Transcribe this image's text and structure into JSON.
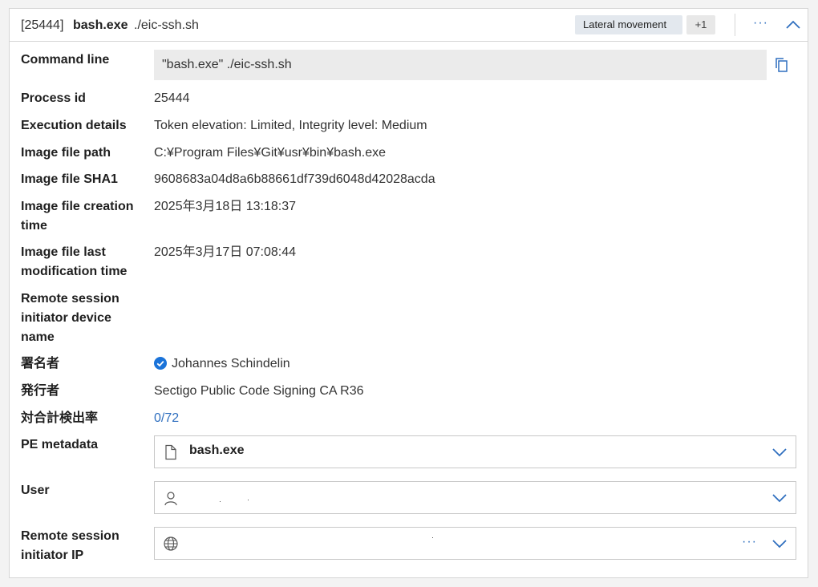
{
  "header": {
    "pid": "[25444]",
    "process_name": "bash.exe",
    "argument": "./eic-ssh.sh",
    "tags": [
      "Lateral movement",
      "+1"
    ],
    "more_label": "···"
  },
  "fields": {
    "command_line": {
      "label": "Command line",
      "value": "\"bash.exe\" ./eic-ssh.sh"
    },
    "process_id": {
      "label": "Process id",
      "value": "25444"
    },
    "execution_details": {
      "label": "Execution details",
      "value": "Token elevation: Limited, Integrity level: Medium"
    },
    "image_file_path": {
      "label": "Image file path",
      "value": "C:¥Program Files¥Git¥usr¥bin¥bash.exe"
    },
    "image_file_sha1": {
      "label": "Image file SHA1",
      "value": "9608683a04d8a6b88661df739d6048d42028acda"
    },
    "image_creation_time": {
      "label_line1": "Image file creation",
      "label_line2": "time",
      "value": "2025年3月18日 13:18:37"
    },
    "image_modification_time": {
      "label_line1": "Image file last",
      "label_line2": "modification time",
      "value": "2025年3月17日 07:08:44"
    },
    "remote_session_device": {
      "label_line1": "Remote session",
      "label_line2": "initiator device",
      "label_line3": "name"
    },
    "signer": {
      "label": "署名者",
      "value": "Johannes Schindelin"
    },
    "issuer": {
      "label": "発行者",
      "value": "Sectigo Public Code Signing CA R36"
    },
    "detection_ratio": {
      "label": "対合計検出率",
      "value": "0/72"
    },
    "pe_metadata": {
      "label": "PE metadata",
      "value": "bash.exe"
    },
    "user": {
      "label": "User",
      "value": ""
    },
    "remote_session_ip": {
      "label_line1": "Remote session",
      "label_line2": "initiator IP",
      "value": "",
      "more_label": "···"
    }
  },
  "colors": {
    "accent": "#2f6fbf",
    "tag_bg": "#e3e8ee",
    "verified": "#1a73d9"
  }
}
